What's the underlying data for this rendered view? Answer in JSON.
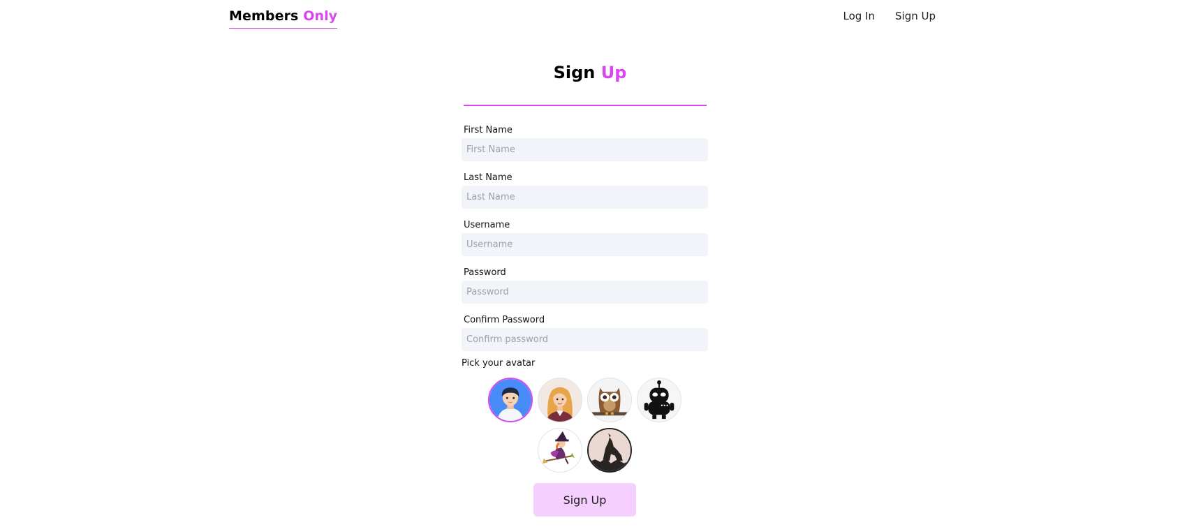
{
  "brand": {
    "main": "Members",
    "accent": "Only"
  },
  "nav": {
    "login": "Log In",
    "signup": "Sign Up"
  },
  "title": {
    "main": "Sign",
    "accent": "Up"
  },
  "fields": [
    {
      "label": "First Name",
      "placeholder": "First Name",
      "value": ""
    },
    {
      "label": "Last Name",
      "placeholder": "Last Name",
      "value": ""
    },
    {
      "label": "Username",
      "placeholder": "Username",
      "value": ""
    },
    {
      "label": "Password",
      "placeholder": "Password",
      "value": ""
    },
    {
      "label": "Confirm Password",
      "placeholder": "Confirm password",
      "value": ""
    }
  ],
  "avatar_picker": {
    "label": "Pick your avatar",
    "options": [
      "boy-avatar-icon",
      "girl-avatar-icon",
      "owl-avatar-icon",
      "robot-avatar-icon",
      "witch-avatar-icon",
      "wolf-avatar-icon"
    ],
    "selected": "boy-avatar-icon"
  },
  "submit_label": "Sign Up",
  "colors": {
    "accent": "#d946ef",
    "button_bg": "#f5d0fe",
    "input_bg": "#f1f4f8"
  }
}
